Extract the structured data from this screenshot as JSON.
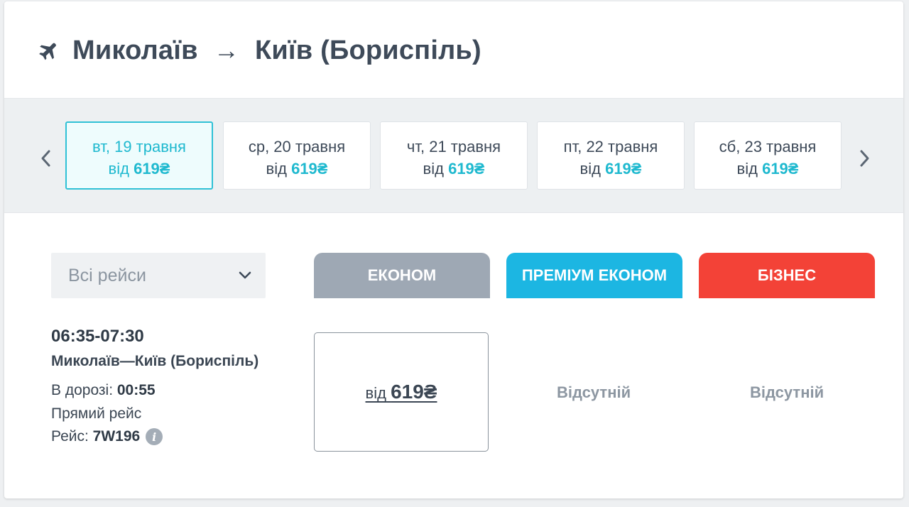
{
  "header": {
    "from": "Миколаїв",
    "arrow": "→",
    "to": "Київ (Бориспіль)"
  },
  "dates": [
    {
      "day": "вт, 19 травня",
      "prefix": "від",
      "price": "619₴",
      "active": true
    },
    {
      "day": "ср, 20 травня",
      "prefix": "від",
      "price": "619₴",
      "active": false
    },
    {
      "day": "чт, 21 травня",
      "prefix": "від",
      "price": "619₴",
      "active": false
    },
    {
      "day": "пт, 22 травня",
      "prefix": "від",
      "price": "619₴",
      "active": false
    },
    {
      "day": "сб, 23 травня",
      "prefix": "від",
      "price": "619₴",
      "active": false
    }
  ],
  "filter": {
    "label": "Всі рейси"
  },
  "tabs": [
    {
      "label": "ЕКОНОМ",
      "color": "#9ea8b4"
    },
    {
      "label": "ПРЕМІУМ ЕКОНОМ",
      "color": "#1cb6e2"
    },
    {
      "label": "БІЗНЕС",
      "color": "#f34237"
    }
  ],
  "flight": {
    "time": "06:35-07:30",
    "route": "Миколаїв—Київ (Бориспіль)",
    "duration_label": "В дорозі:",
    "duration": "00:55",
    "direct": "Прямий рейс",
    "number_label": "Рейс:",
    "number": "7W196",
    "info_icon": "i"
  },
  "fares": {
    "economy": {
      "prefix": "від",
      "price": "619₴"
    },
    "premium": "Відсутній",
    "business": "Відсутній"
  },
  "colors": {
    "accent": "#1fb9cf",
    "text": "#3e4a59"
  }
}
